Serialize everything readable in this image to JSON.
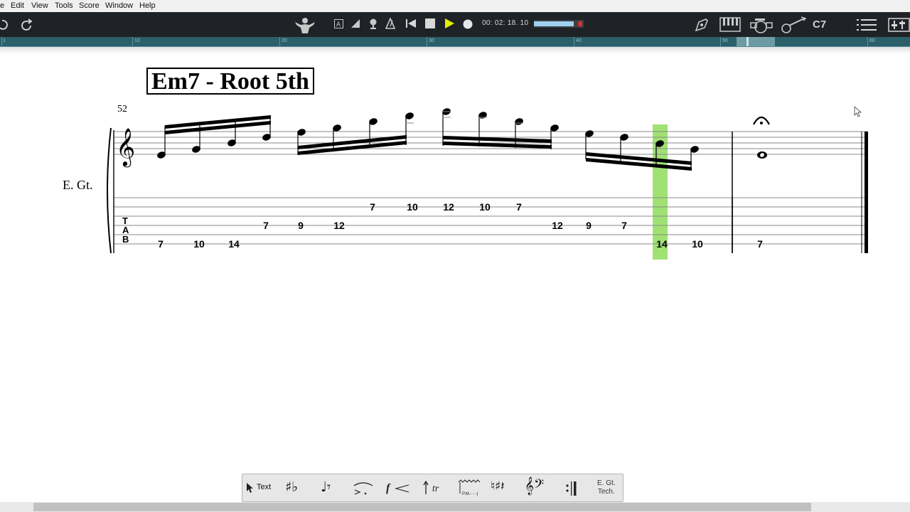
{
  "menu": {
    "items": [
      "e",
      "Edit",
      "View",
      "Tools",
      "Score",
      "Window",
      "Help"
    ]
  },
  "transport": {
    "timecode": "00: 02: 18. 10",
    "volume_level": 0.8
  },
  "toolbar": {
    "key_label": "C7"
  },
  "ruler": {
    "labels": [
      "1",
      "10",
      "20",
      "30",
      "40",
      "50",
      "60"
    ]
  },
  "score": {
    "title": "Em7 - Root 5th",
    "measure_number": "52",
    "instrument": "E. Gt.",
    "tab_clef": [
      "T",
      "A",
      "B"
    ],
    "tab_numbers": [
      "7",
      "10",
      "14",
      "7",
      "9",
      "12",
      "7",
      "10",
      "12",
      "10",
      "7",
      "12",
      "9",
      "7",
      "14",
      "10",
      "7"
    ]
  },
  "palette": {
    "text_label": "Text",
    "etech_label_1": "E. Gt.",
    "etech_label_2": "Tech."
  },
  "colors": {
    "toolbar_bg": "#1f2327",
    "ruler_bg": "#2b5f6a",
    "highlight": "#8fdc5c",
    "play": "#e4f000",
    "record_meter": "#9fd0ee"
  }
}
